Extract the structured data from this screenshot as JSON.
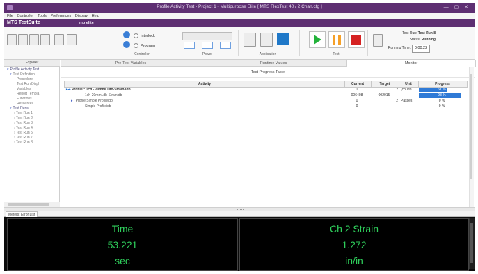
{
  "window": {
    "title": "Profile Activity Test - Project 1 - Multipurpose Elite [ MTS FlexTest 40 / 2 Chan.cfg ]",
    "controls": "— ▢ ✕"
  },
  "menu": [
    "File",
    "Controller",
    "Tools",
    "Preferences",
    "Display",
    "Help"
  ],
  "brand": {
    "logo": "MTS TestSuite",
    "profile": "mp elite"
  },
  "toolbar": {
    "controller": {
      "label": "Controller",
      "interlock": "Interlock",
      "program": "Program"
    },
    "power_label": "Power",
    "application_label": "Application",
    "test_label": "Test"
  },
  "status": {
    "test_run_label": "Test Run:",
    "test_run": "Test Run 8",
    "status_label": "Status:",
    "status": "Running",
    "running_time_label": "Running Time:",
    "running_time": "0:00:22"
  },
  "explorer": {
    "title": "Explorer",
    "items": [
      "Profile Activity Test",
      "Test Definition",
      "Procedure",
      "Test Run Displ",
      "Variables",
      "Report Templa",
      "Functions",
      "Resources",
      "Test Runs",
      "Test Run 1",
      "Test Run 2",
      "Test Run 3",
      "Test Run 4",
      "Test Run 5",
      "Test Run 7",
      "Test Run 8"
    ]
  },
  "tabs": [
    "Pre-Test Variables",
    "Runtime Values",
    "Monitor"
  ],
  "progress_table": {
    "title": "Test Progress Table",
    "columns": [
      "Activity",
      "Current",
      "Target",
      "Unit",
      "Progress"
    ],
    "rows": [
      {
        "activity": "Profiler: 1ch - 20mmLDtb-Strain-Idb",
        "current": "1",
        "target": "2",
        "unit": "(count)",
        "progress_label": "61 %",
        "progress": 0.61
      },
      {
        "activity": "1ch-20mmLdb-Strainidb",
        "current": "006408",
        "target": "002015",
        "unit": "",
        "progress_label": "93 %",
        "progress": 0.93
      },
      {
        "activity": "Profile Simple Profileidb",
        "current": "0",
        "target": "2",
        "unit": "Passes",
        "progress_label": "0 %",
        "progress": 0
      },
      {
        "activity": "Simple Profileidb",
        "current": "0",
        "target": "",
        "unit": "",
        "progress_label": "0 %",
        "progress": 0
      }
    ]
  },
  "meters_tab": "Meters: Error List",
  "meters": [
    {
      "name": "Time",
      "value": "53.221",
      "unit": "sec"
    },
    {
      "name": "Ch 2 Strain",
      "value": "1.272",
      "unit": "in/in"
    }
  ],
  "colors": {
    "brand": "#5e2f72",
    "meter_text": "#2fd05c",
    "progress_fill": "#2f7ad6",
    "play": "#23b23a",
    "pause": "#f5a028",
    "stop": "#d52121"
  }
}
